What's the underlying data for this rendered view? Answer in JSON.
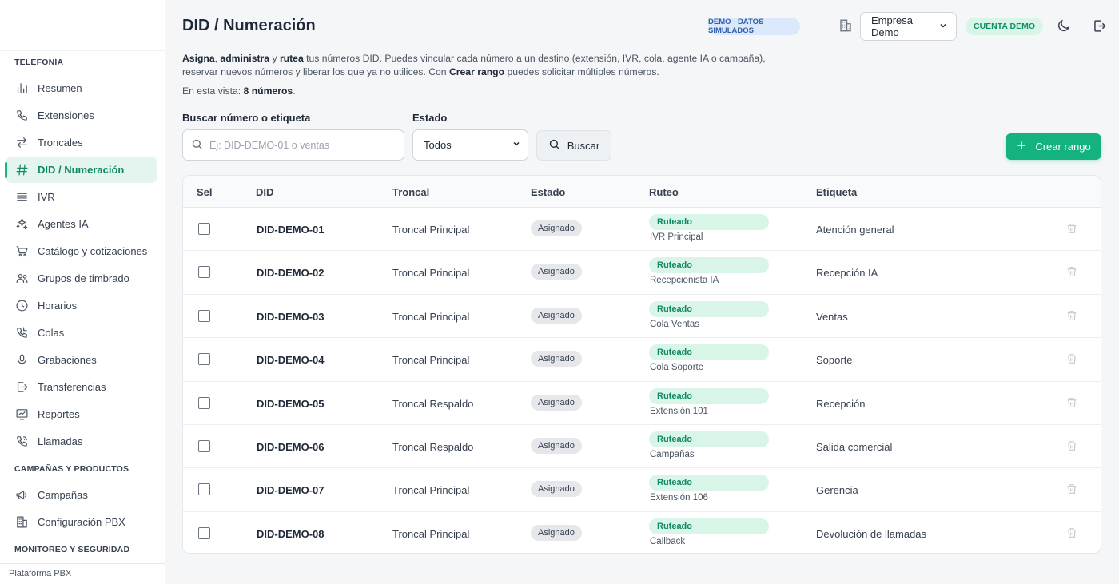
{
  "sidebar": {
    "sections": [
      {
        "title": "TELEFONÍA",
        "items": [
          {
            "label": "Resumen",
            "icon": "bar-chart-icon"
          },
          {
            "label": "Extensiones",
            "icon": "phone-icon"
          },
          {
            "label": "Troncales",
            "icon": "arrows-exchange-icon"
          },
          {
            "label": "DID / Numeración",
            "icon": "hash-icon",
            "active": true
          },
          {
            "label": "IVR",
            "icon": "list-icon"
          },
          {
            "label": "Agentes IA",
            "icon": "sparkles-icon"
          },
          {
            "label": "Catálogo y cotizaciones",
            "icon": "cart-icon"
          },
          {
            "label": "Grupos de timbrado",
            "icon": "users-icon"
          },
          {
            "label": "Horarios",
            "icon": "clock-icon"
          },
          {
            "label": "Colas",
            "icon": "phone-queue-icon"
          },
          {
            "label": "Grabaciones",
            "icon": "microphone-icon"
          },
          {
            "label": "Transferencias",
            "icon": "transfer-icon"
          },
          {
            "label": "Reportes",
            "icon": "report-icon"
          },
          {
            "label": "Llamadas",
            "icon": "phone-call-icon"
          }
        ]
      },
      {
        "title": "CAMPAÑAS Y PRODUCTOS",
        "items": [
          {
            "label": "Campañas",
            "icon": "megaphone-icon"
          },
          {
            "label": "Configuración PBX",
            "icon": "building-icon"
          }
        ]
      },
      {
        "title": "MONITOREO Y SEGURIDAD",
        "items": []
      }
    ],
    "footer": "Plataforma PBX"
  },
  "header": {
    "title": "DID / Numeración",
    "demo_badge": "DEMO - DATOS SIMULADOS",
    "company": "Empresa Demo",
    "account_badge": "CUENTA DEMO"
  },
  "description": {
    "w1": "Asigna",
    "sep1": ", ",
    "w2": "administra",
    "sep2": " y ",
    "w3": "rutea",
    "text1": " tus números DID. Puedes vincular cada número a un destino (extensión, IVR, cola, agente IA o campaña), reservar nuevos números y liberar los que ya no utilices. Con ",
    "w4": "Crear rango",
    "text2": " puedes solicitar múltiples números."
  },
  "count": {
    "prefix": "En esta vista: ",
    "value": "8 números",
    "suffix": "."
  },
  "filters": {
    "search_label": "Buscar número o etiqueta",
    "search_placeholder": "Ej: DID-DEMO-01 o ventas",
    "search_value": "",
    "estado_label": "Estado",
    "estado_value": "Todos",
    "search_button": "Buscar",
    "create_button": "Crear rango"
  },
  "table": {
    "columns": [
      "Sel",
      "DID",
      "Troncal",
      "Estado",
      "Ruteo",
      "Etiqueta"
    ],
    "rows": [
      {
        "did": "DID-DEMO-01",
        "troncal": "Troncal Principal",
        "estado": "Asignado",
        "ruteo": "Ruteado",
        "destino": "IVR Principal",
        "etiqueta": "Atención general"
      },
      {
        "did": "DID-DEMO-02",
        "troncal": "Troncal Principal",
        "estado": "Asignado",
        "ruteo": "Ruteado",
        "destino": "Recepcionista IA",
        "etiqueta": "Recepción IA"
      },
      {
        "did": "DID-DEMO-03",
        "troncal": "Troncal Principal",
        "estado": "Asignado",
        "ruteo": "Ruteado",
        "destino": "Cola Ventas",
        "etiqueta": "Ventas"
      },
      {
        "did": "DID-DEMO-04",
        "troncal": "Troncal Principal",
        "estado": "Asignado",
        "ruteo": "Ruteado",
        "destino": "Cola Soporte",
        "etiqueta": "Soporte"
      },
      {
        "did": "DID-DEMO-05",
        "troncal": "Troncal Respaldo",
        "estado": "Asignado",
        "ruteo": "Ruteado",
        "destino": "Extensión 101",
        "etiqueta": "Recepción"
      },
      {
        "did": "DID-DEMO-06",
        "troncal": "Troncal Respaldo",
        "estado": "Asignado",
        "ruteo": "Ruteado",
        "destino": "Campañas",
        "etiqueta": "Salida comercial"
      },
      {
        "did": "DID-DEMO-07",
        "troncal": "Troncal Principal",
        "estado": "Asignado",
        "ruteo": "Ruteado",
        "destino": "Extensión 106",
        "etiqueta": "Gerencia"
      },
      {
        "did": "DID-DEMO-08",
        "troncal": "Troncal Principal",
        "estado": "Asignado",
        "ruteo": "Ruteado",
        "destino": "Callback",
        "etiqueta": "Devolución de llamadas"
      }
    ]
  },
  "colors": {
    "accent": "#14b27e",
    "active_bg": "#e3f5ee",
    "demo_badge_bg": "#dbe8fb",
    "ruteado_bg": "#d9f5e8"
  }
}
